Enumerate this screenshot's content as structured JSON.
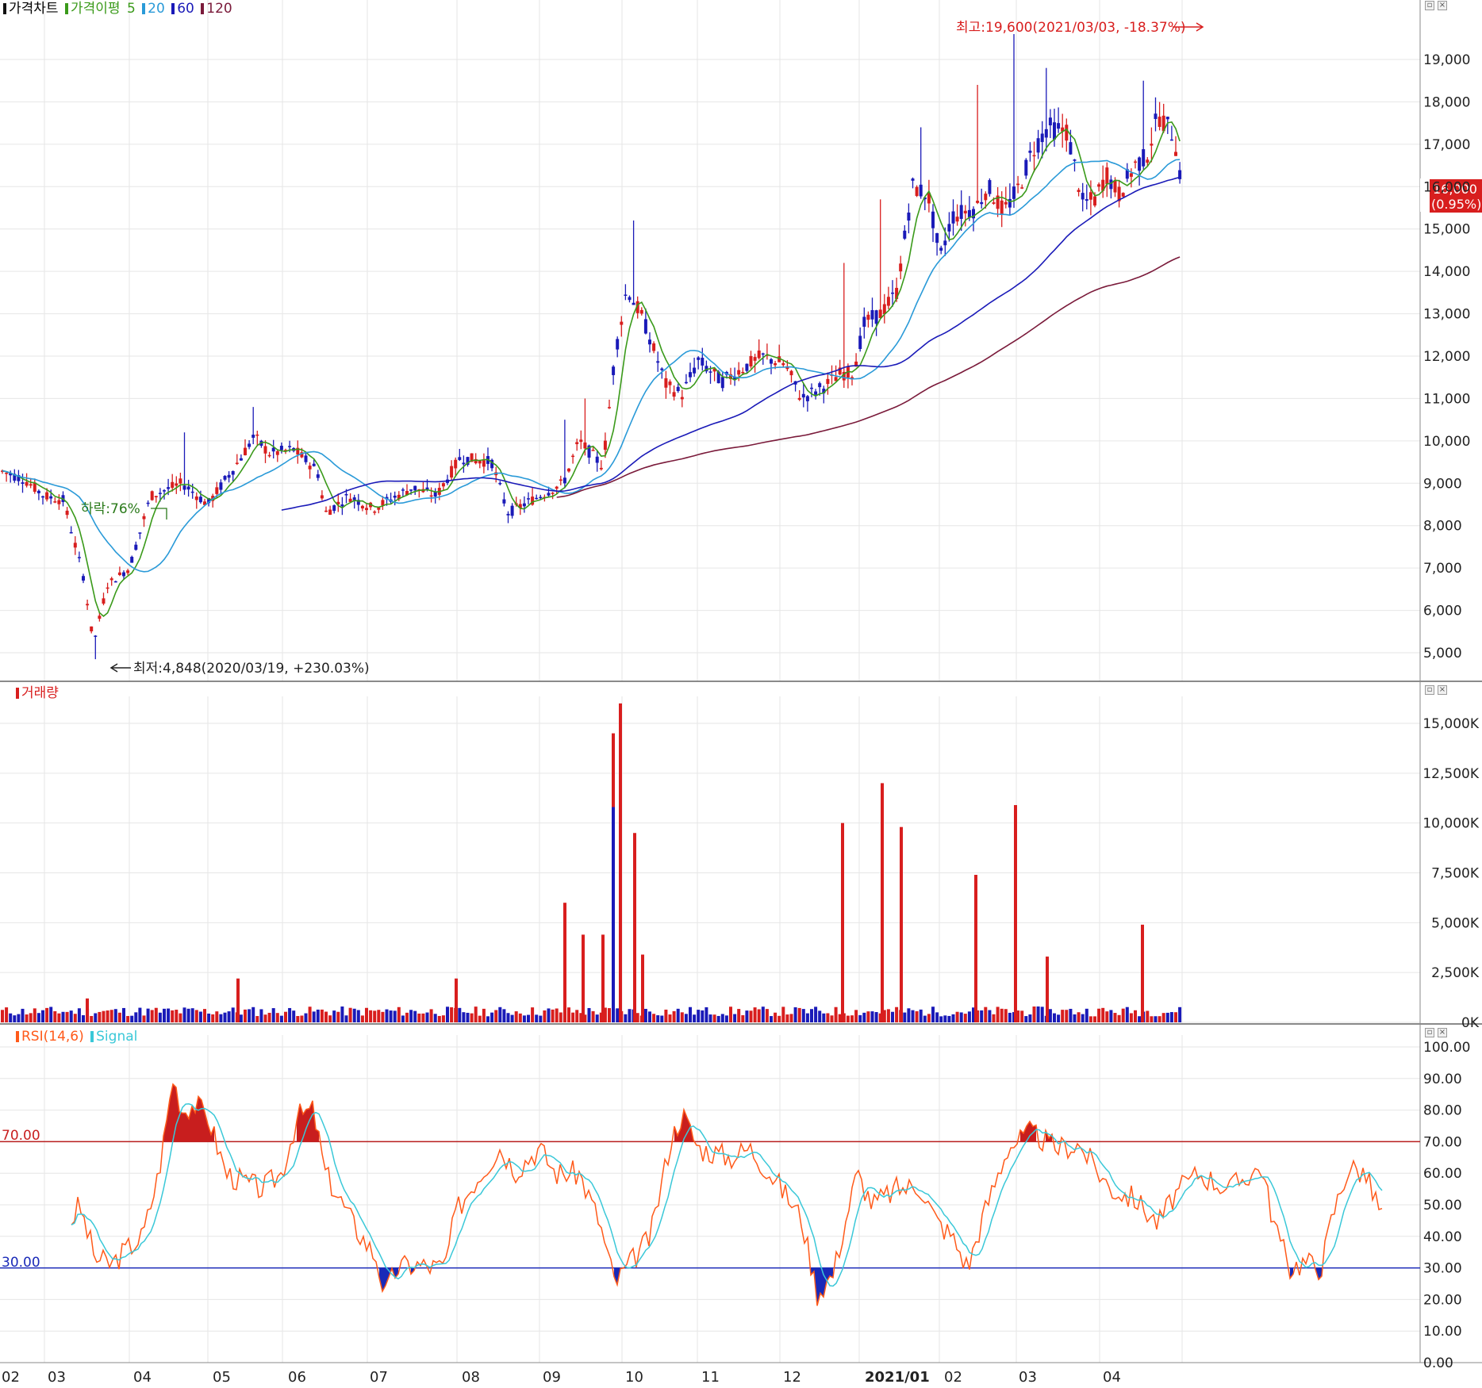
{
  "panes": {
    "price": {
      "title": "가격차트",
      "indicator": "가격이평",
      "ma_periods": [
        "5",
        "20",
        "60",
        "120"
      ],
      "ma_colors": [
        "#3a9a1a",
        "#2a9ad8",
        "#1a1ab8",
        "#7a1a3a"
      ],
      "high_label": "최고:19,600(2021/03/03, -18.37%)",
      "low_label": "최저:4,848(2020/03/19, +230.03%)",
      "drop_label": "하락:76%",
      "last_price": "16,000",
      "last_change": "(0.95%)"
    },
    "volume": {
      "title": "거래량"
    },
    "rsi": {
      "title": "RSI(14,6)",
      "signal_title": "Signal",
      "upper_level_label": "70.00",
      "lower_level_label": "30.00"
    }
  },
  "x_axis": {
    "labels": [
      "02",
      "03",
      "04",
      "05",
      "06",
      "07",
      "08",
      "09",
      "10",
      "11",
      "12",
      "2021/01",
      "02",
      "03",
      "04"
    ]
  },
  "chart_data": [
    {
      "type": "candlestick",
      "title": "가격차트",
      "x_range": [
        "2020/02",
        "2021/04"
      ],
      "ylim": [
        4500,
        20000
      ],
      "y_ticks": [
        "5,000",
        "6,000",
        "7,000",
        "8,000",
        "9,000",
        "10,000",
        "11,000",
        "12,000",
        "13,000",
        "14,000",
        "15,000",
        "16,000",
        "17,000",
        "18,000",
        "19,000"
      ],
      "key_points": [
        {
          "date": "2020/02",
          "close": 9300
        },
        {
          "date": "2020/03/19",
          "low": 4848
        },
        {
          "date": "2020/04",
          "close": 8800
        },
        {
          "date": "2020/05",
          "close": 10000
        },
        {
          "date": "2020/06",
          "close": 8300
        },
        {
          "date": "2020/08",
          "close": 9500
        },
        {
          "date": "2020/09",
          "close": 8600
        },
        {
          "date": "2020/10",
          "high": 15200,
          "close": 13500
        },
        {
          "date": "2020/11",
          "close": 11300
        },
        {
          "date": "2020/12",
          "close": 11000
        },
        {
          "date": "2021/01",
          "close": 13000
        },
        {
          "date": "2021/02",
          "close": 16000
        },
        {
          "date": "2021/03/03",
          "high": 19600
        },
        {
          "date": "2021/04",
          "close": 16000
        }
      ],
      "last": 16000,
      "series": [
        {
          "name": "5",
          "color": "#3a9a1a"
        },
        {
          "name": "20",
          "color": "#2a9ad8"
        },
        {
          "name": "60",
          "color": "#1a1ab8"
        },
        {
          "name": "120",
          "color": "#7a1a3a"
        }
      ]
    },
    {
      "type": "bar",
      "title": "거래량",
      "ylim": [
        0,
        16500
      ],
      "y_ticks": [
        "0K",
        "2,500K",
        "5,000K",
        "7,500K",
        "10,000K",
        "12,500K",
        "15,000K"
      ],
      "peaks_k": [
        {
          "date": "2020/03",
          "value": 1200
        },
        {
          "date": "2020/05",
          "value": 2200
        },
        {
          "date": "2020/08",
          "value": 2200
        },
        {
          "date": "2020/09",
          "value": 6000
        },
        {
          "date": "2020/09",
          "value": 4400
        },
        {
          "date": "2020/09",
          "value": 4400
        },
        {
          "date": "2020/10",
          "value": 14500
        },
        {
          "date": "2020/10",
          "value": 16000
        },
        {
          "date": "2020/10",
          "value": 9500
        },
        {
          "date": "2020/10",
          "value": 3400
        },
        {
          "date": "2020/12",
          "value": 10000
        },
        {
          "date": "2021/01",
          "value": 12000
        },
        {
          "date": "2021/01",
          "value": 9800
        },
        {
          "date": "2021/02",
          "value": 7400
        },
        {
          "date": "2021/03",
          "value": 10900
        },
        {
          "date": "2021/03",
          "value": 3300
        },
        {
          "date": "2021/04",
          "value": 4900
        }
      ]
    },
    {
      "type": "line",
      "title": "RSI(14,6)",
      "ylim": [
        0,
        100
      ],
      "y_ticks": [
        "0.00",
        "10.00",
        "20.00",
        "30.00",
        "40.00",
        "50.00",
        "60.00",
        "70.00",
        "80.00",
        "90.00",
        "100.00"
      ],
      "levels": [
        70,
        30
      ],
      "series": [
        {
          "name": "RSI(14,6)",
          "color": "#ff5a1a"
        },
        {
          "name": "Signal",
          "color": "#3ac8d8"
        }
      ],
      "key_points": [
        {
          "date": "2020/03",
          "rsi": 30
        },
        {
          "date": "2020/04",
          "rsi": 91
        },
        {
          "date": "2020/05",
          "rsi": 80
        },
        {
          "date": "2020/06",
          "rsi": 21
        },
        {
          "date": "2020/07",
          "rsi": 70
        },
        {
          "date": "2020/08",
          "rsi": 21
        },
        {
          "date": "2020/09",
          "rsi": 79
        },
        {
          "date": "2020/10",
          "rsi": 68
        },
        {
          "date": "2020/11",
          "rsi": 21
        },
        {
          "date": "2020/12",
          "rsi": 29
        },
        {
          "date": "2021/01",
          "rsi": 76
        },
        {
          "date": "2021/02",
          "rsi": 45
        },
        {
          "date": "2021/03",
          "rsi": 63
        },
        {
          "date": "2021/04",
          "rsi": 45
        }
      ]
    }
  ]
}
